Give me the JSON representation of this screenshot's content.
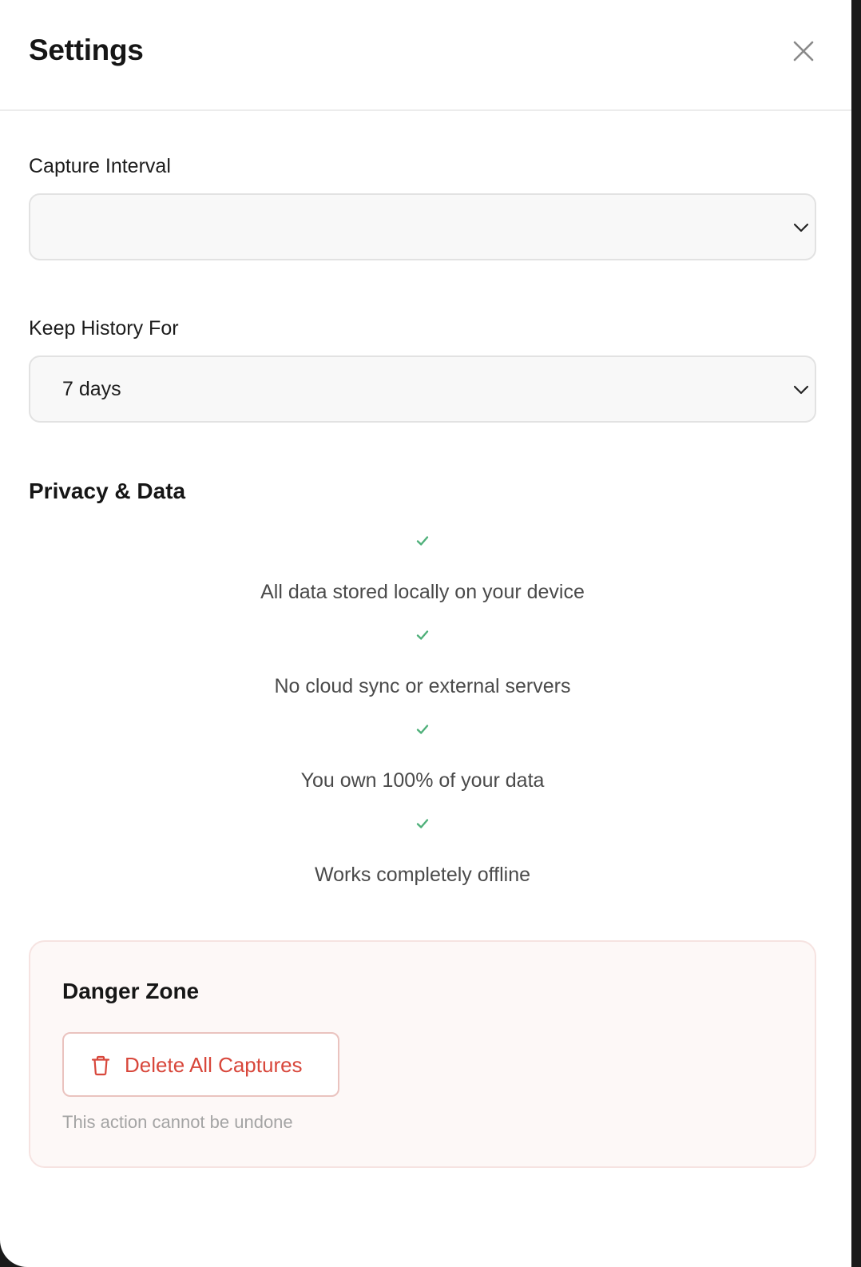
{
  "header": {
    "title": "Settings",
    "close_icon": "close-icon"
  },
  "capture_interval": {
    "label": "Capture Interval",
    "value": ""
  },
  "keep_history": {
    "label": "Keep History For",
    "value": "7 days"
  },
  "privacy": {
    "title": "Privacy & Data",
    "check_icon": "check-icon",
    "check_color": "#4fb07a",
    "items": [
      "All data stored locally on your device",
      "No cloud sync or external servers",
      "You own 100% of your data",
      "Works completely offline"
    ]
  },
  "danger_zone": {
    "title": "Danger Zone",
    "delete_label": "Delete All Captures",
    "delete_icon": "trash-icon",
    "accent_color": "#d8473b",
    "note": "This action cannot be undone"
  }
}
